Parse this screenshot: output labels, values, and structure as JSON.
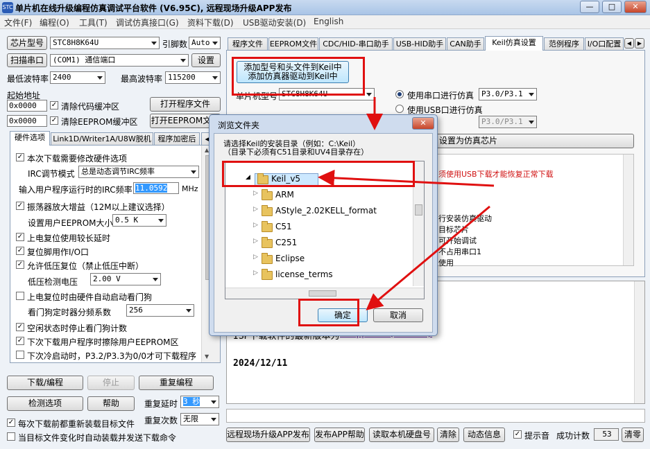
{
  "window": {
    "title": "单片机在线升级编程仿真调试平台软件 (V6.95C), 远程现场升级APP发布",
    "icon": "STC",
    "min": "—",
    "max": "□",
    "close": "✕"
  },
  "menu": [
    "文件(F)",
    "编程(O)",
    "工具(T)",
    "调试仿真接口(G)",
    "资料下载(D)",
    "USB驱动安装(D)",
    "English"
  ],
  "left": {
    "chip_btn": "芯片型号",
    "chip_value": "STC8H8K64U",
    "pin_label": "引脚数",
    "pin_value": "Auto",
    "scan_btn": "扫描串口",
    "com_value": "(COM1) 通信端口",
    "settings_btn": "设置",
    "min_baud_label": "最低波特率",
    "min_baud": "2400",
    "max_baud_label": "最高波特率",
    "max_baud": "115200",
    "start_addr_label": "起始地址",
    "addr1": "0x0000",
    "clear_code": "清除代码缓冲区",
    "open_prog_btn": "打开程序文件",
    "addr2": "0x0000",
    "clear_eeprom": "清除EEPROM缓冲区",
    "open_eeprom_btn": "打开EEPROM文件",
    "tabs": [
      "硬件选项",
      "Link1D/Writer1A/U8W脱机",
      "程序加密后",
      "◀▶"
    ],
    "opts": {
      "o1": "本次下载需要修改硬件选项",
      "irc_mode_label": "IRC调节模式",
      "irc_mode": "总是动态调节IRC频率",
      "irc_freq_label": "输入用户程序运行时的IRC频率",
      "irc_freq": "11.0592",
      "irc_unit": "MHz",
      "o2": "振荡器放大增益（12M以上建议选择）",
      "eeprom_size_label": "设置用户EEPROM大小",
      "eeprom_size": "0.5 K",
      "o3": "上电复位使用较长延时",
      "o4": "复位脚用作I/O口",
      "o5": "允许低压复位（禁止低压中断）",
      "lvd_label": "低压检测电压",
      "lvd": "2.00 V",
      "o6": "上电复位时由硬件自动启动看门狗",
      "wdt_label": "看门狗定时器分频系数",
      "wdt": "256",
      "o7": "空闲状态时停止看门狗计数",
      "o8": "下次下载用户程序时擦除用户EEPROM区",
      "o9": "下次冷启动时，P3.2/P3.3为0/0才可下载程序"
    },
    "download_btn": "下载/编程",
    "stop_btn": "停止",
    "redownload_btn": "重复编程",
    "detect_btn": "检测选项",
    "help_btn": "帮助",
    "delay_label": "重复延时",
    "delay": "3 秒",
    "count_label": "重复次数",
    "count": "无限",
    "reload_each": "每次下载前都重新装载目标文件",
    "auto_send": "当目标文件变化时自动装载并发送下载命令"
  },
  "right": {
    "tabs": [
      "程序文件",
      "EEPROM文件",
      "CDC/HID-串口助手",
      "USB-HID助手",
      "CAN助手",
      "Keil仿真设置",
      "范例程序",
      "I/O口配置"
    ],
    "add_keil_btn_l1": "添加型号和头文件到Keil中",
    "add_keil_btn_l2": "添加仿真器驱动到Keil中",
    "mcu_label": "单片机型号",
    "mcu_value": "STC8H8K64U",
    "use_uart": "使用串口进行仿真",
    "uart_pins": "P3.0/P3.1",
    "use_usb": "使用USB口进行仿真",
    "pins_disabled": "P3.0/P3.1",
    "set_sim_chip": "设置为仿真芯片",
    "usb_note": "须使用USB下载才能恢复正常下载",
    "notes": [
      "行安装仿真驱动",
      "目标芯片",
      "可开始调试",
      "不占用串口1",
      "使用"
    ],
    "news_text": "ISP下载软件的最新版本为",
    "news_link": "AIapp-ISP(V6.95C)",
    "date": "2024/12/11",
    "bottom_btns": [
      "远程现场升级APP发布",
      "发布APP帮助",
      "读取本机硬盘号",
      "清除",
      "动态信息"
    ],
    "beep": "提示音",
    "success_label": "成功计数",
    "success_count": "53",
    "clear_count_btn": "清零"
  },
  "dialog": {
    "title": "浏览文件夹",
    "close": "✕",
    "desc_l1": "请选择Keil的安装目录（例如：C:\\Keil）",
    "desc_l2": "（目录下必须有C51目录和UV4目录存在）",
    "tree": [
      "Keil_v5",
      "ARM",
      "AStyle_2.02KELL_format",
      "C51",
      "C251",
      "Eclipse",
      "license_terms"
    ],
    "ok": "确定",
    "cancel": "取消"
  },
  "colors": {
    "annotation_red": "#e01010",
    "link": "#5a1fa0",
    "note_red": "#d01010",
    "highlight": "#3399ff"
  }
}
